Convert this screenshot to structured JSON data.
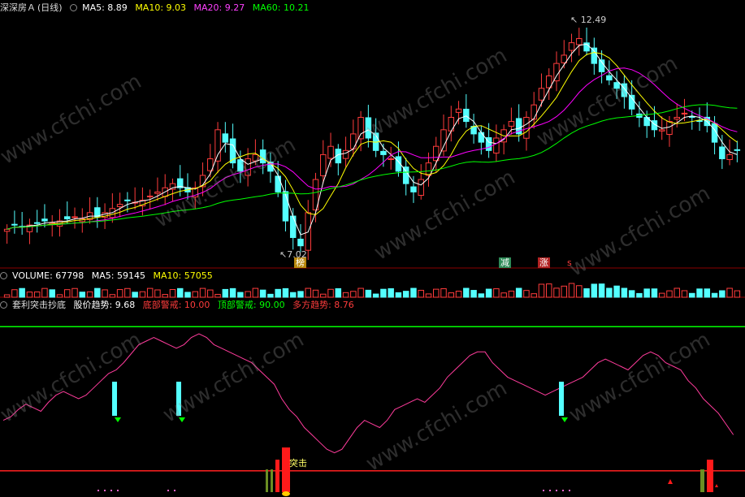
{
  "main_header": {
    "stock_name": "深深房Ａ",
    "period": "(日线)",
    "ma5": "MA5: 8.89",
    "ma10": "MA10: 9.03",
    "ma20": "MA20: 9.27",
    "ma60": "MA60: 10.21"
  },
  "volume_header": {
    "volume": "VOLUME: 67798",
    "ma5": "MA5: 59145",
    "ma10": "MA10: 57055"
  },
  "indicator_header": {
    "name": "套利突击抄底",
    "trend": "股价趋势: 9.68",
    "bottom_alert": "底部警戒: 10.00",
    "top_alert": "顶部警戒: 90.00",
    "bull_trend": "多方趋势: 8.76"
  },
  "annotations": {
    "high_label": "12.49",
    "low_label": "7.02",
    "tag_bang": "榜",
    "tag_jian": "减",
    "tag_zhang": "涨",
    "tag_s": "s",
    "tag_tuji": "突击"
  },
  "watermark": "www.cfchi.com",
  "colors": {
    "up": "#ff3c3c",
    "down": "#54ffff",
    "ma5": "#ffffff",
    "ma10": "#ffff00",
    "ma20": "#ff00ff",
    "ma60": "#00ff00",
    "guide": "#00ff00",
    "indicator": "#ff3c9c"
  },
  "chart_data": {
    "type": "candlestick",
    "price_range": [
      7.02,
      12.49
    ],
    "closes": [
      7.6,
      7.7,
      7.65,
      7.7,
      7.75,
      7.8,
      7.75,
      7.8,
      7.85,
      7.9,
      7.85,
      8.0,
      7.9,
      8.0,
      8.1,
      8.2,
      8.3,
      8.25,
      8.3,
      8.4,
      8.5,
      8.6,
      8.7,
      8.6,
      8.5,
      8.6,
      8.9,
      9.3,
      10.0,
      9.7,
      9.2,
      9.0,
      9.3,
      9.4,
      9.2,
      9.0,
      8.5,
      7.8,
      7.4,
      7.2,
      8.0,
      8.8,
      9.4,
      9.6,
      9.2,
      9.5,
      9.9,
      10.3,
      9.8,
      9.5,
      9.4,
      9.3,
      9.0,
      8.7,
      8.5,
      8.8,
      9.2,
      9.6,
      10.0,
      10.3,
      10.5,
      10.2,
      9.9,
      9.7,
      9.5,
      9.8,
      10.0,
      10.2,
      9.9,
      10.3,
      10.6,
      11.0,
      11.3,
      11.6,
      11.8,
      12.1,
      12.2,
      11.9,
      11.6,
      11.4,
      11.2,
      11.0,
      10.8,
      10.5,
      10.3,
      10.1,
      10.0,
      10.0,
      10.2,
      10.3,
      10.4,
      10.3,
      10.2,
      10.1,
      9.7,
      9.3,
      9.4,
      9.5
    ],
    "bottom_alert": 10.0,
    "top_alert": 90.0,
    "stock_trend": [
      38,
      40,
      44,
      47,
      45,
      43,
      48,
      52,
      54,
      52,
      50,
      52,
      56,
      60,
      64,
      66,
      70,
      75,
      80,
      82,
      84,
      82,
      80,
      78,
      80,
      84,
      86,
      84,
      80,
      78,
      76,
      74,
      72,
      70,
      66,
      62,
      58,
      50,
      44,
      40,
      34,
      30,
      26,
      22,
      20,
      22,
      28,
      34,
      38,
      36,
      34,
      38,
      44,
      46,
      48,
      50,
      48,
      52,
      56,
      62,
      66,
      70,
      74,
      76,
      76,
      70,
      66,
      62,
      60,
      58,
      56,
      54,
      52,
      54,
      56,
      58,
      60,
      62,
      66,
      70,
      72,
      70,
      68,
      66,
      70,
      74,
      76,
      74,
      70,
      68,
      66,
      60,
      56,
      50,
      46,
      42,
      36,
      30
    ]
  }
}
